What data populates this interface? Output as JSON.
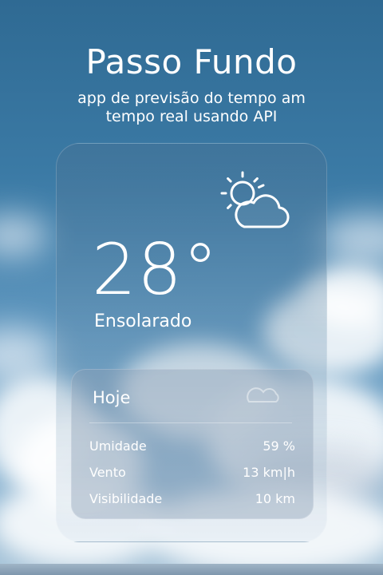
{
  "header": {
    "city": "Passo Fundo",
    "subtitle": "app de previsão do tempo am tempo real usando API"
  },
  "weather": {
    "icon": "partly-sunny-icon",
    "temperature": "28°",
    "condition": "Ensolarado"
  },
  "details": {
    "heading": "Hoje",
    "rows": [
      {
        "label": "Umidade",
        "value": "59 %"
      },
      {
        "label": "Vento",
        "value": "13 km|h"
      },
      {
        "label": "Visibilidade",
        "value": "10 km"
      }
    ]
  }
}
